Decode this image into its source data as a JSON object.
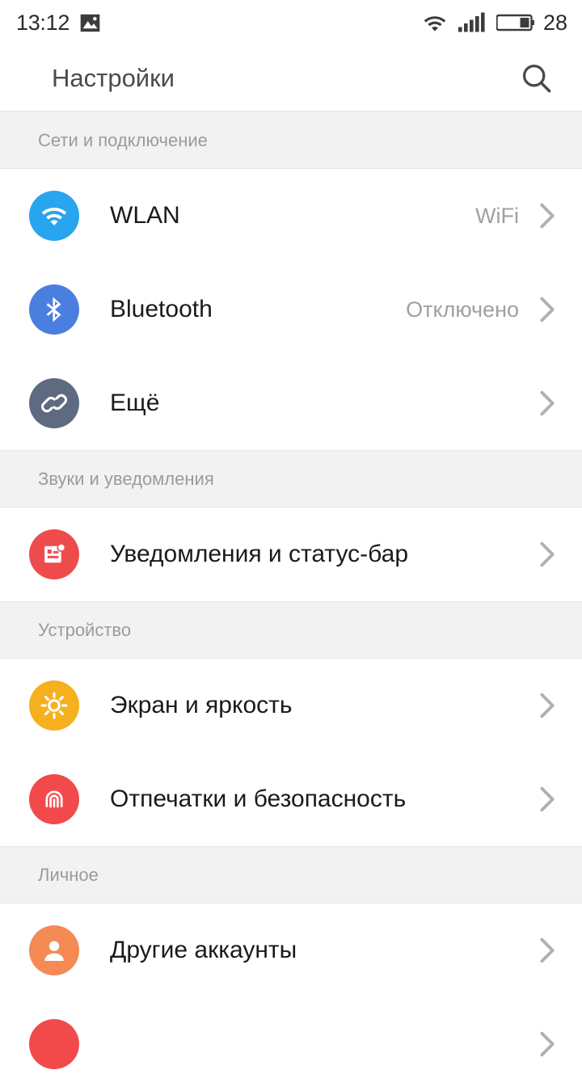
{
  "statusbar": {
    "clock": "13:12",
    "icons": [
      "image-icon",
      "wifi-icon",
      "cellular-signal-icon",
      "battery-icon"
    ],
    "battery_level": "28"
  },
  "header": {
    "title": "Настройки",
    "search_icon": "search-icon"
  },
  "sections": [
    {
      "header": "Сети и подключение",
      "rows": [
        {
          "label": "WLAN",
          "value": "WiFi",
          "icon": "wifi-icon",
          "color": "#29a4ee"
        },
        {
          "label": "Bluetooth",
          "value": "Отключено",
          "icon": "bluetooth-icon",
          "color": "#4a7fe0"
        },
        {
          "label": "Ещё",
          "value": "",
          "icon": "link-icon",
          "color": "#5e6a80"
        }
      ]
    },
    {
      "header": "Звуки и уведомления",
      "rows": [
        {
          "label": "Уведомления и статус-бар",
          "value": "",
          "icon": "notification-icon",
          "color": "#ee4c4c"
        }
      ]
    },
    {
      "header": "Устройство",
      "rows": [
        {
          "label": "Экран и яркость",
          "value": "",
          "icon": "brightness-sun-icon",
          "color": "#f6b01e"
        },
        {
          "label": "Отпечатки и безопасность",
          "value": "",
          "icon": "fingerprint-icon",
          "color": "#f24a4a"
        }
      ]
    },
    {
      "header": "Личное",
      "rows": [
        {
          "label": "Другие аккаунты",
          "value": "",
          "icon": "account-person-icon",
          "color": "#f58a55"
        },
        {
          "label": "",
          "value": "",
          "icon": "partial-row-icon",
          "color": "#f24a4a"
        }
      ]
    }
  ]
}
